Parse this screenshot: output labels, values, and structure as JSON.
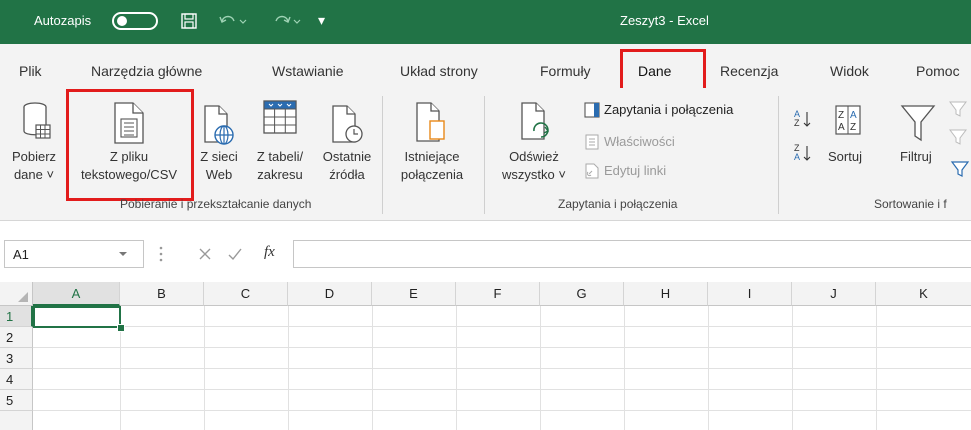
{
  "titlebar": {
    "autosave_label": "Autozapis",
    "window_title": "Zeszyt3 - Excel",
    "qat_more": "▾"
  },
  "tabs": [
    {
      "label": "Plik"
    },
    {
      "label": "Narzędzia główne"
    },
    {
      "label": "Wstawianie"
    },
    {
      "label": "Układ strony"
    },
    {
      "label": "Formuły"
    },
    {
      "label": "Dane",
      "active": true
    },
    {
      "label": "Recenzja"
    },
    {
      "label": "Widok"
    },
    {
      "label": "Pomoc"
    }
  ],
  "ribbon": {
    "get_data": {
      "line1": "Pobierz",
      "line2": "dane ˅"
    },
    "from_text": {
      "line1": "Z pliku",
      "line2": "tekstowego/CSV"
    },
    "from_web": {
      "line1": "Z sieci",
      "line2": "Web"
    },
    "from_table": {
      "line1": "Z tabeli/",
      "line2": "zakresu"
    },
    "recent": {
      "line1": "Ostatnie",
      "line2": "źródła"
    },
    "existing": {
      "line1": "Istniejące",
      "line2": "połączenia"
    },
    "group1_label": "Pobieranie i przekształcanie danych",
    "refresh": {
      "line1": "Odśwież",
      "line2": "wszystko ˅"
    },
    "queries_connections": "Zapytania i połączenia",
    "properties": "Właściwości",
    "edit_links": "Edytuj linki",
    "group2_label": "Zapytania i połączenia",
    "sort": "Sortuj",
    "filter": "Filtruj",
    "group3_label": "Sortowanie i f"
  },
  "formula_bar": {
    "name_box": "A1",
    "fx": "fx",
    "value": ""
  },
  "grid": {
    "columns": [
      "A",
      "B",
      "C",
      "D",
      "E",
      "F",
      "G",
      "H",
      "I",
      "J",
      "K"
    ],
    "rows": [
      "1",
      "2",
      "3",
      "4",
      "5"
    ],
    "selected_cell": "A1"
  },
  "colors": {
    "excel_green": "#217346",
    "highlight_red": "#e21b1b"
  }
}
